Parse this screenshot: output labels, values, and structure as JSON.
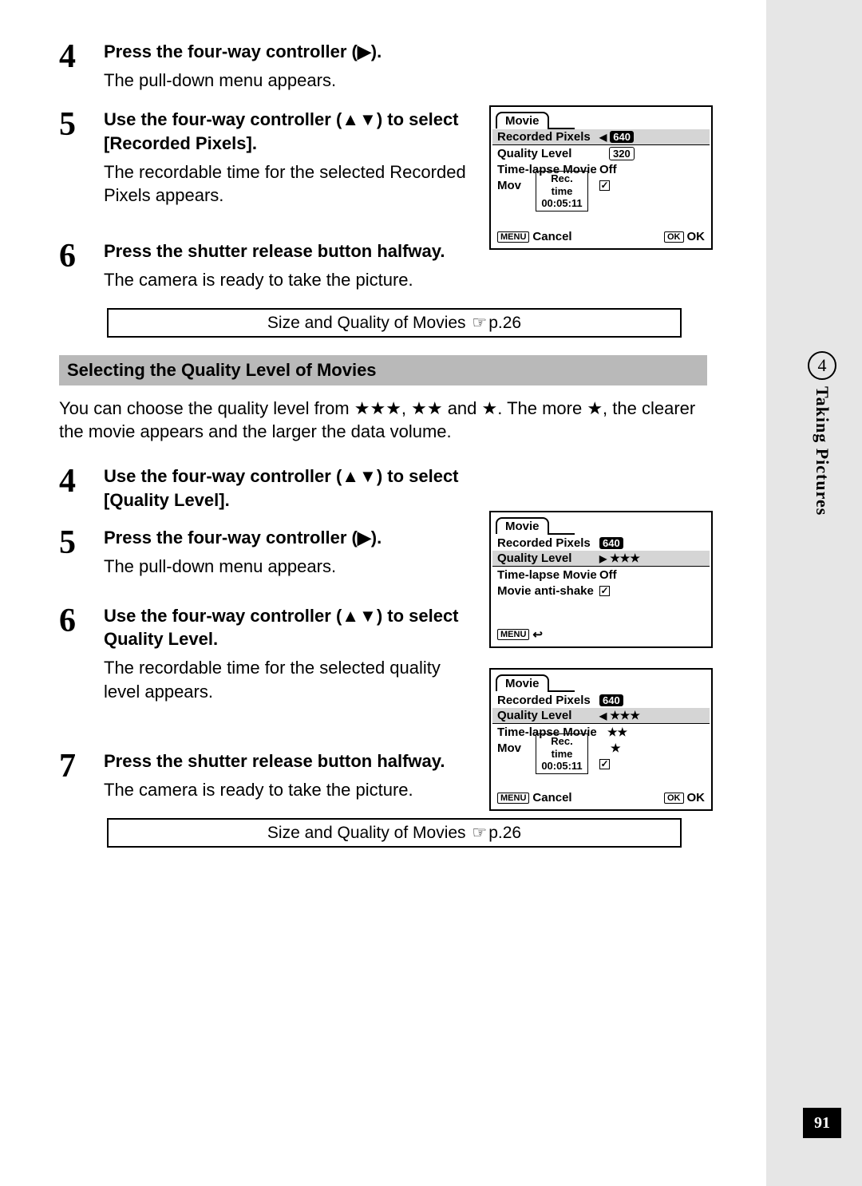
{
  "a": {
    "s4": {
      "num": "4",
      "title": "Press the four-way controller (▶).",
      "desc": "The pull-down menu appears."
    },
    "s5": {
      "num": "5",
      "title": "Use the four-way controller (▲▼) to select [Recorded Pixels].",
      "desc": "The recordable time for the selected Recorded Pixels appears."
    },
    "s6": {
      "num": "6",
      "title": "Press the shutter release button halfway.",
      "desc": "The camera is ready to take the picture."
    },
    "ref": "Size and Quality of Movies ",
    "refpage": "p.26"
  },
  "section": {
    "title": "Selecting the Quality Level of Movies",
    "intro": "You can choose the quality level from ★★★, ★★ and ★. The more ★, the clearer the movie appears and the larger the data volume."
  },
  "b": {
    "s4": {
      "num": "4",
      "title": "Use the four-way controller (▲▼) to select [Quality Level]."
    },
    "s5": {
      "num": "5",
      "title": "Press the four-way controller (▶).",
      "desc": "The pull-down menu appears."
    },
    "s6": {
      "num": "6",
      "title": "Use the four-way controller (▲▼) to select Quality Level.",
      "desc": "The recordable time for the selected quality level appears."
    },
    "s7": {
      "num": "7",
      "title": "Press the shutter release button halfway.",
      "desc": "The camera is ready to take the picture."
    },
    "ref": "Size and Quality of Movies ",
    "refpage": "p.26"
  },
  "scr1": {
    "tab": "Movie",
    "r1": {
      "label": "Recorded Pixels",
      "val": "640"
    },
    "r2": {
      "label": "Quality Level",
      "val": "320"
    },
    "r3": {
      "label": "Time-lapse Movie",
      "val": "Off"
    },
    "r4": {
      "label": "Mov"
    },
    "rec": {
      "label": "Rec. time",
      "val": "00:05:11"
    },
    "footer": {
      "menu": "MENU",
      "cancel": "Cancel",
      "okbtn": "OK",
      "ok": "OK"
    }
  },
  "scr2": {
    "tab": "Movie",
    "r1": {
      "label": "Recorded Pixels",
      "val": "640"
    },
    "r2": {
      "label": "Quality Level",
      "val": "★★★"
    },
    "r3": {
      "label": "Time-lapse Movie",
      "val": "Off"
    },
    "r4": {
      "label": "Movie anti-shake"
    },
    "footer": {
      "menu": "MENU"
    }
  },
  "scr3": {
    "tab": "Movie",
    "r1": {
      "label": "Recorded Pixels",
      "val": "640"
    },
    "r2": {
      "label": "Quality Level"
    },
    "r3": {
      "label": "Time-lapse Movie"
    },
    "r4": {
      "label": "Mov"
    },
    "opts": [
      "★★★",
      "★★",
      "★"
    ],
    "rec": {
      "label": "Rec. time",
      "val": "00:05:11"
    },
    "footer": {
      "menu": "MENU",
      "cancel": "Cancel",
      "okbtn": "OK",
      "ok": "OK"
    }
  },
  "side": {
    "num": "4",
    "title": "Taking Pictures"
  },
  "pagenum": "91"
}
